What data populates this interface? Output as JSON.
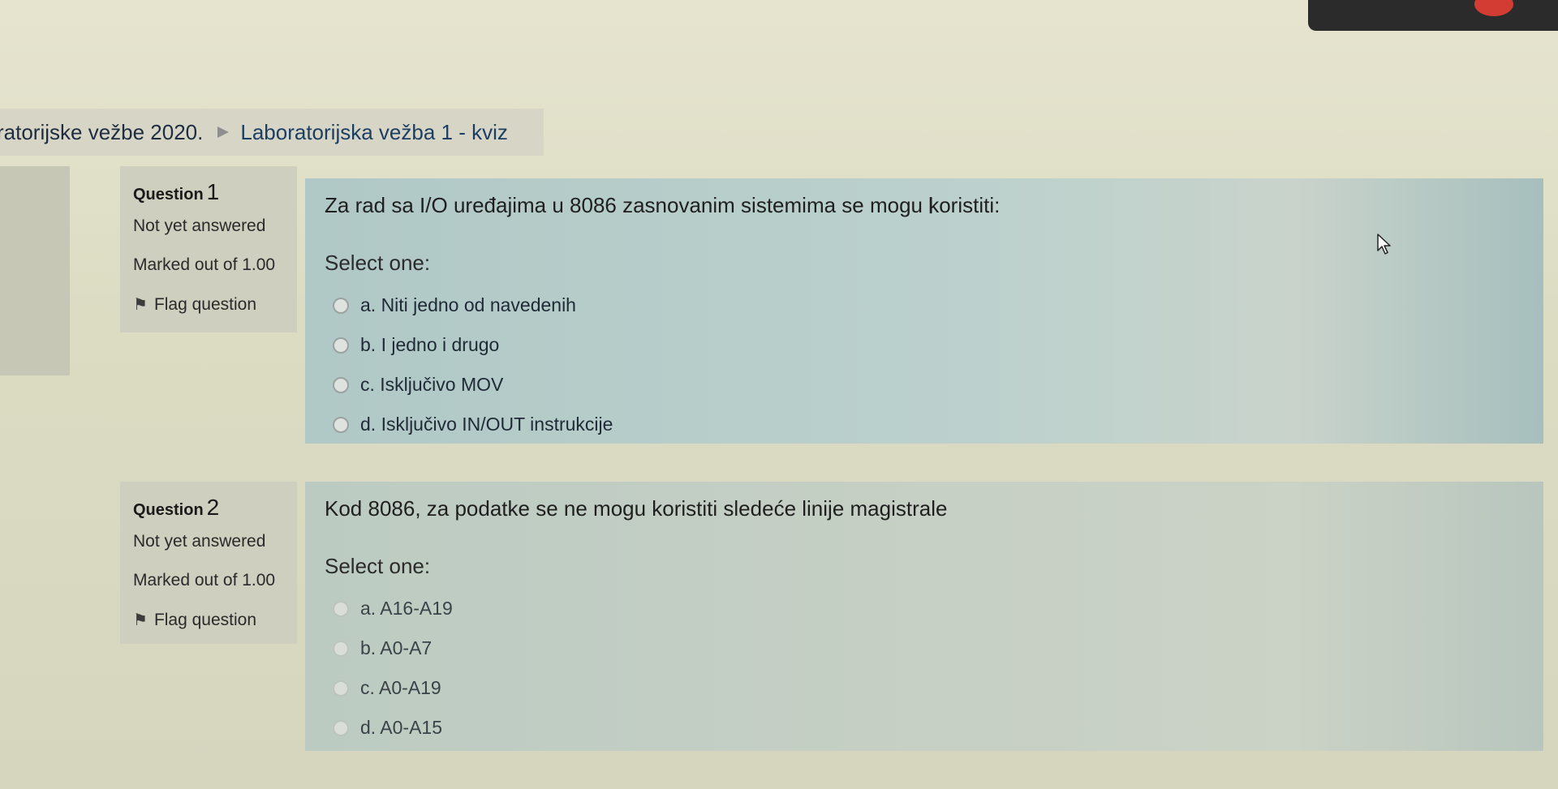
{
  "breadcrumb": {
    "previous": "ratorijske vežbe 2020.",
    "current": "Laboratorijska vežba 1 - kviz"
  },
  "questions": [
    {
      "label": "Question",
      "number": "1",
      "status": "Not yet answered",
      "marks": "Marked out of 1.00",
      "flag_label": "Flag question",
      "text": "Za rad sa I/O uređajima u 8086 zasnovanim sistemima se mogu koristiti:",
      "select_prompt": "Select one:",
      "answers": [
        "a. Niti jedno od navedenih",
        "b. I jedno i drugo",
        "c. Isključivo MOV",
        "d. Isključivo IN/OUT instrukcije"
      ]
    },
    {
      "label": "Question",
      "number": "2",
      "status": "Not yet answered",
      "marks": "Marked out of 1.00",
      "flag_label": "Flag question",
      "text": "Kod 8086, za podatke se ne mogu koristiti sledeće linije magistrale",
      "select_prompt": "Select one:",
      "answers": [
        "a. A16-A19",
        "b. A0-A7",
        "c. A0-A19",
        "d. A0-A15"
      ]
    }
  ],
  "icons": {
    "breadcrumb_separator": "triangle-right-icon",
    "flag": "flag-icon",
    "mouse_pointer": "mouse-pointer-icon",
    "text_cursor": "text-cursor-icon"
  }
}
